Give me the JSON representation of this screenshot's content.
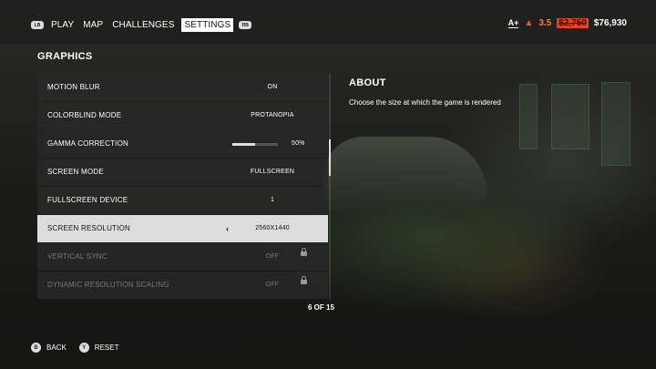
{
  "nav": {
    "left_bumper": "LB",
    "right_bumper": "RB",
    "items": [
      "PLAY",
      "MAP",
      "CHALLENGES",
      "SETTINGS"
    ],
    "active": "SETTINGS"
  },
  "stats": {
    "rank": "A+",
    "heat": "3.5",
    "old_price": "$2,750",
    "money": "$76,930"
  },
  "section_title": "GRAPHICS",
  "settings": [
    {
      "label": "MOTION BLUR",
      "value": "ON"
    },
    {
      "label": "COLORBLIND MODE",
      "value": "PROTANOPIA"
    },
    {
      "label": "GAMMA CORRECTION",
      "value": "50%",
      "slider": 0.5
    },
    {
      "label": "SCREEN MODE",
      "value": "FULLSCREEN"
    },
    {
      "label": "FULLSCREEN DEVICE",
      "value": "1"
    },
    {
      "label": "SCREEN RESOLUTION",
      "value": "2560X1440",
      "selected": true
    },
    {
      "label": "VERTICAL SYNC",
      "value": "OFF",
      "locked": true
    },
    {
      "label": "DYNAMIC RESOLUTION SCALING",
      "value": "OFF",
      "locked": true
    }
  ],
  "pager": "6 OF 15",
  "about": {
    "title": "ABOUT",
    "text": "Choose the size at which the game is rendered"
  },
  "footer": {
    "back_key": "B",
    "back_label": "BACK",
    "reset_key": "Y",
    "reset_label": "RESET"
  },
  "icons": {
    "heat": "flame-icon",
    "locked": "lock-icon",
    "selected_arrow": "chevron-left-icon"
  },
  "colors": {
    "accent_orange": "#e0442b",
    "selected_row": "#dcdcdc"
  }
}
